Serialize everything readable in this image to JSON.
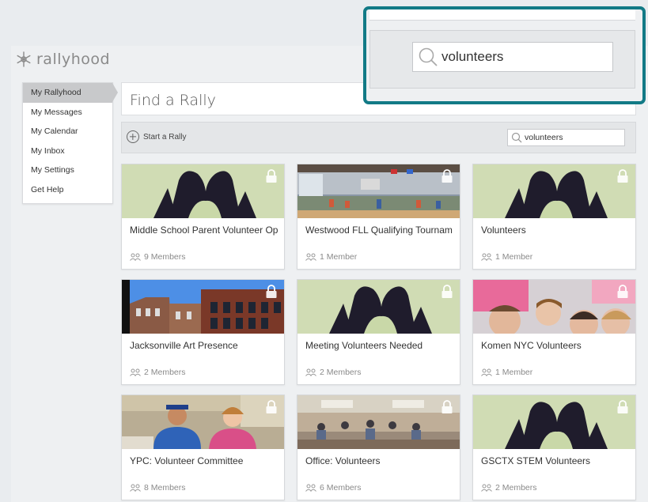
{
  "brand": {
    "name": "rallyhood",
    "icon": "snowflake-logo-icon"
  },
  "sidebar": {
    "items": [
      {
        "label": "My Rallyhood",
        "active": true
      },
      {
        "label": "My Messages"
      },
      {
        "label": "My Calendar"
      },
      {
        "label": "My Inbox"
      },
      {
        "label": "My Settings"
      },
      {
        "label": "Get Help"
      }
    ]
  },
  "header": {
    "title": "Find a Rally"
  },
  "toolbar": {
    "start_label": "Start a Rally",
    "search_value": "volunteers"
  },
  "zoom": {
    "search_value": "volunteers"
  },
  "colors": {
    "callout_border": "#127a86"
  },
  "rallies": [
    {
      "title": "Middle School Parent Volunteer Op",
      "members": "9 Members",
      "image": "heart-hands"
    },
    {
      "title": "Westwood FLL Qualifying Tournam",
      "members": "1 Member",
      "image": "gym"
    },
    {
      "title": "Volunteers",
      "members": "1 Member",
      "image": "heart-hands"
    },
    {
      "title": "Jacksonville Art Presence",
      "members": "2 Members",
      "image": "brick-buildings"
    },
    {
      "title": "Meeting Volunteers Needed",
      "members": "2 Members",
      "image": "heart-hands"
    },
    {
      "title": "Komen NYC Volunteers",
      "members": "1 Member",
      "image": "pink-crowd"
    },
    {
      "title": "YPC: Volunteer Committee",
      "members": "8 Members",
      "image": "two-people"
    },
    {
      "title": "Office: Volunteers",
      "members": "6 Members",
      "image": "meeting-room"
    },
    {
      "title": "GSCTX STEM Volunteers",
      "members": "2 Members",
      "image": "heart-hands"
    }
  ]
}
